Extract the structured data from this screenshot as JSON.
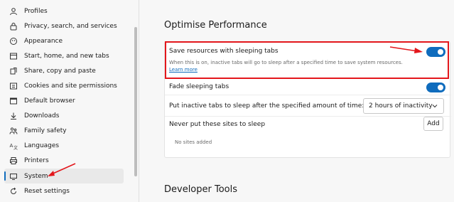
{
  "sidebar": {
    "items": [
      {
        "label": "Profiles",
        "icon": "profile-icon"
      },
      {
        "label": "Privacy, search, and services",
        "icon": "lock-icon"
      },
      {
        "label": "Appearance",
        "icon": "appearance-icon"
      },
      {
        "label": "Start, home, and new tabs",
        "icon": "home-tabs-icon"
      },
      {
        "label": "Share, copy and paste",
        "icon": "share-icon"
      },
      {
        "label": "Cookies and site permissions",
        "icon": "cookies-icon"
      },
      {
        "label": "Default browser",
        "icon": "browser-icon"
      },
      {
        "label": "Downloads",
        "icon": "download-icon"
      },
      {
        "label": "Family safety",
        "icon": "family-icon"
      },
      {
        "label": "Languages",
        "icon": "languages-icon"
      },
      {
        "label": "Printers",
        "icon": "printer-icon"
      },
      {
        "label": "System",
        "icon": "system-icon",
        "active": true
      },
      {
        "label": "Reset settings",
        "icon": "reset-icon"
      }
    ]
  },
  "main": {
    "section_title": "Optimise Performance",
    "sleeping_tabs": {
      "label": "Save resources with sleeping tabs",
      "description": "When this is on, inactive tabs will go to sleep after a specified time to save system resources.",
      "learn_more": "Learn more",
      "enabled": true
    },
    "fade_sleeping_tabs": {
      "label": "Fade sleeping tabs",
      "enabled": true
    },
    "inactive_timeout": {
      "label": "Put inactive tabs to sleep after the specified amount of time:",
      "selected": "2 hours of inactivity"
    },
    "never_sleep": {
      "label": "Never put these sites to sleep",
      "add_label": "Add",
      "empty_text": "No sites added"
    },
    "developer_title": "Developer Tools"
  },
  "colors": {
    "accent": "#0f6cbd",
    "annotation": "#e3171c"
  }
}
